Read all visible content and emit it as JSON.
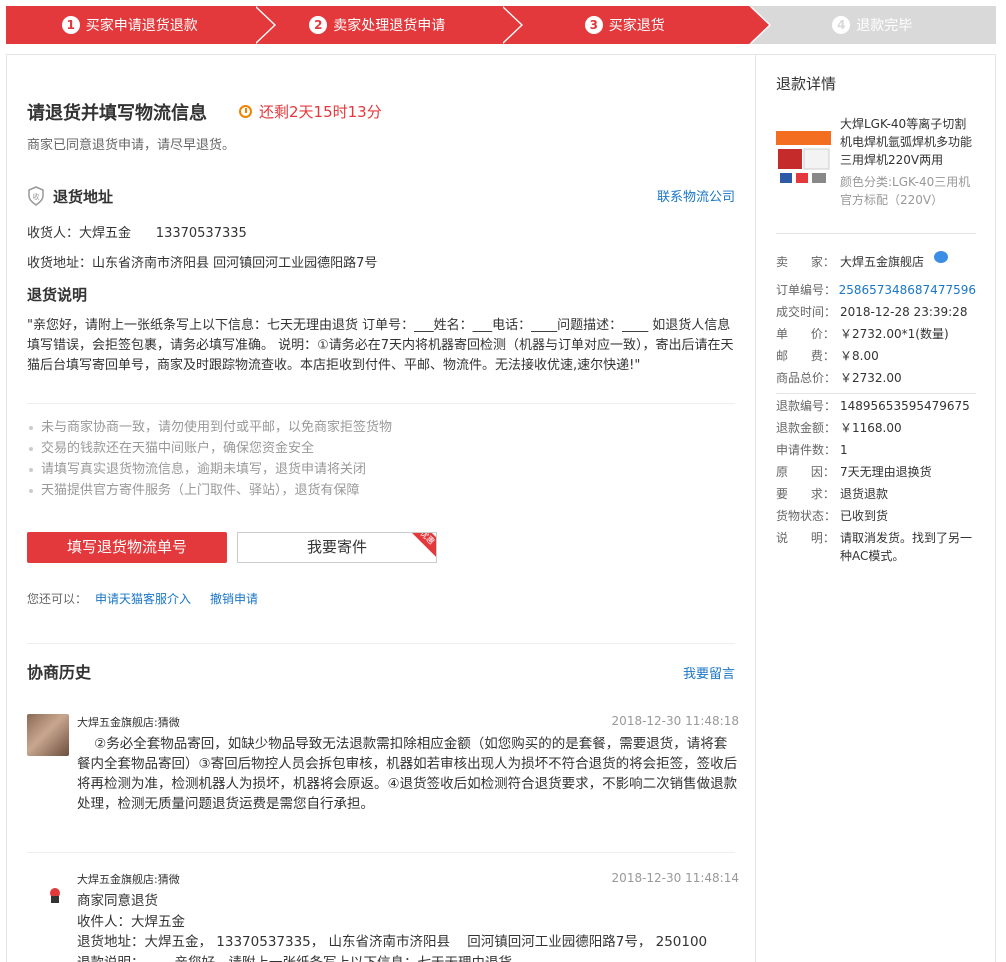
{
  "steps": [
    {
      "num": "1",
      "label": "买家申请退货退款"
    },
    {
      "num": "2",
      "label": "卖家处理退货申请"
    },
    {
      "num": "3",
      "label": "买家退货"
    },
    {
      "num": "4",
      "label": "退款完毕"
    }
  ],
  "main": {
    "title": "请退货并填写物流信息",
    "timer": "还剩2天15时13分",
    "subtitle": "商家已同意退货申请，请尽早退货。",
    "addr_head": "退货地址",
    "logistics_link": "联系物流公司",
    "receiver": "收货人：大焊五金      13370537335",
    "address": "收货地址：山东省济南市济阳县 回河镇回河工业园德阳路7号",
    "desc_head": "退货说明",
    "desc": "\"亲您好，请附上一张纸条写上以下信息：七天无理由退货 订单号：___姓名：___电话：____问题描述：____ 如退货人信息填写错误，会拒签包裹，请务必填写准确。 说明：①请务必在7天内将机器寄回检测（机器与订单对应一致），寄出后请在天猫后台填写寄回单号，商家及时跟踪物流查收。本店拒收到付件、平邮、物流件。无法接收优速,速尔快递!\"",
    "tips": [
      "未与商家协商一致，请勿使用到付或平邮，以免商家拒签货物",
      "交易的钱款还在天猫中间账户，确保您资金安全",
      "请填写真实退货物流信息，逾期未填写，退货申请将关闭",
      "天猫提供官方寄件服务（上门取件、驿站），退货有保障"
    ],
    "btn_fill": "填写退货物流单号",
    "btn_send": "我要寄件",
    "btn_tag": "优惠",
    "also_label": "您还可以：",
    "also_link1": "申请天猫客服介入",
    "also_link2": "撤销申请",
    "history_head": "协商历史",
    "history_link": "我要留言",
    "messages": [
      {
        "name": "大焊五金旗舰店:猜微",
        "time": "2018-12-30 11:48:18",
        "body": "    ②务必全套物品寄回，如缺少物品导致无法退款需扣除相应金额（如您购买的的是套餐，需要退货，请将套餐内全套物品寄回）③寄回后物控人员会拆包审核，机器如若审核出现人为损坏不符合退货的将会拒签，签收后将再检测为准，检测机器人为损坏，机器将会原返。④退货签收后如检测符合退货要求，不影响二次销售做退款处理，检测无质量问题退货运费是需您自行承担。"
      },
      {
        "name": "大焊五金旗舰店:猜微",
        "time": "2018-12-30 11:48:14",
        "body": "商家同意退货\n收件人：大焊五金\n退货地址：大焊五金， 13370537335， 山东省济南市济阳县    回河镇回河工业园德阳路7号， 250100\n退款说明：       亲您好，请附上一张纸条写上以下信息：七天无理由退货"
      }
    ]
  },
  "side": {
    "title": "退款详情",
    "product_name": "大焊LGK-40等离子切割机电焊机氩弧焊机多功能三用焊机220V两用",
    "product_spec": "颜色分类:LGK-40三用机 官方标配（220V）",
    "seller_k": "卖      家：",
    "seller_v": "大焊五金旗舰店",
    "order": [
      {
        "k": "订单编号：",
        "v": "258657348687477596",
        "link": true
      },
      {
        "k": "成交时间：",
        "v": "2018-12-28 23:39:28"
      },
      {
        "k": "单      价：",
        "v": "￥2732.00*1(数量)"
      },
      {
        "k": "邮      费：",
        "v": "￥8.00"
      },
      {
        "k": "商品总价：",
        "v": "￥2732.00"
      }
    ],
    "refund": [
      {
        "k": "退款编号：",
        "v": "14895653595479675"
      },
      {
        "k": "退款金额：",
        "v": "￥1168.00"
      },
      {
        "k": "申请件数：",
        "v": "1"
      },
      {
        "k": "原      因：",
        "v": "7天无理由退换货"
      },
      {
        "k": "要      求：",
        "v": "退货退款"
      },
      {
        "k": "货物状态：",
        "v": "已收到货"
      },
      {
        "k": "说      明：",
        "v": "请取消发货。找到了另一种AC模式。"
      }
    ]
  }
}
